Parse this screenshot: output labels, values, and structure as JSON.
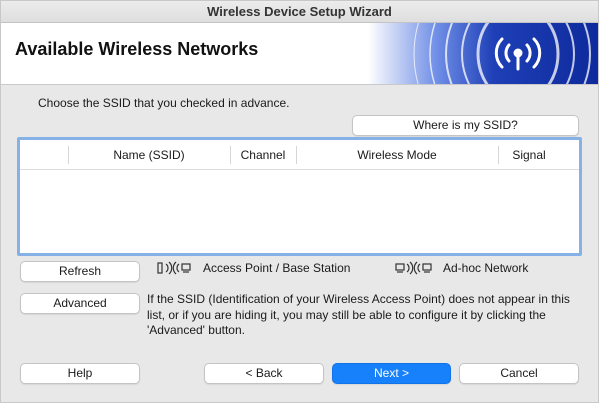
{
  "window": {
    "title": "Wireless Device Setup Wizard"
  },
  "header": {
    "title": "Available Wireless Networks"
  },
  "instruction": "Choose the SSID that you checked in advance.",
  "where_button": "Where is my SSID?",
  "table": {
    "columns": [
      "Name (SSID)",
      "Channel",
      "Wireless Mode",
      "Signal"
    ],
    "rows": []
  },
  "refresh_button": "Refresh",
  "legend": {
    "access_point_label": "Access Point / Base Station",
    "adhoc_label": "Ad-hoc Network",
    "access_point_icon": "access-point-icon",
    "adhoc_icon": "adhoc-network-icon"
  },
  "advanced_button": "Advanced",
  "advanced_note": "If the SSID (Identification of your Wireless Access Point) does not appear in this list, or if you are hiding it, you may still be able to configure it by clicking the 'Advanced' button.",
  "footer": {
    "help": "Help",
    "back": "< Back",
    "next": "Next >",
    "cancel": "Cancel"
  },
  "colors": {
    "accent": "#1681fa",
    "table_focus_border": "#85b1e7",
    "header_art": "#1a3fb8"
  }
}
